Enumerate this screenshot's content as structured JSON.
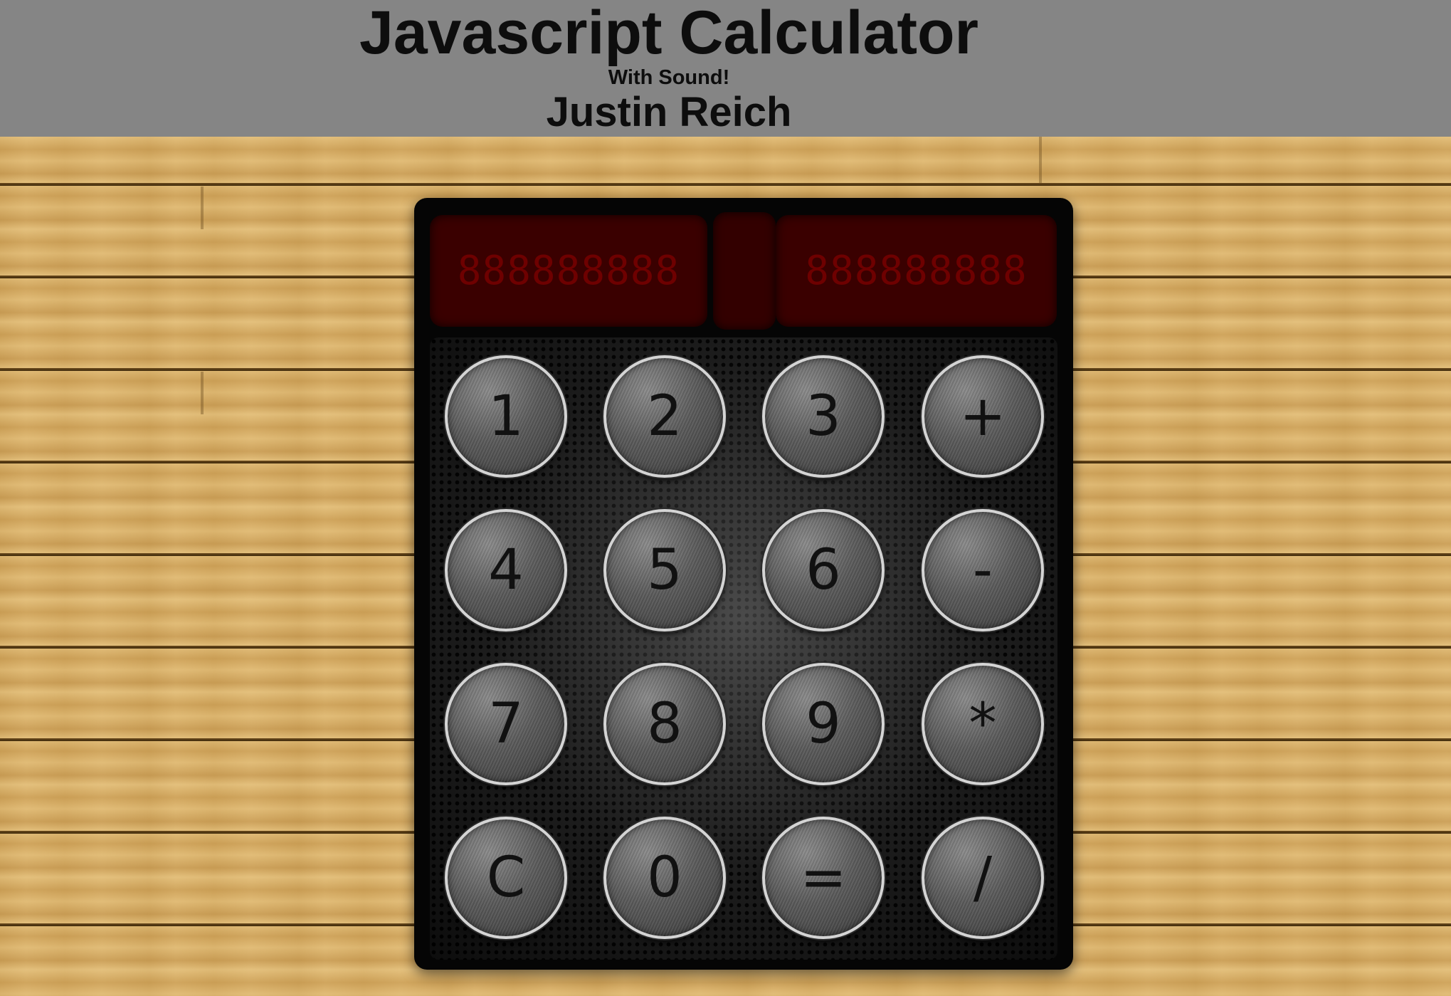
{
  "header": {
    "title": "Javascript Calculator",
    "subtitle": "With Sound!",
    "author": "Justin Reich"
  },
  "display": {
    "left_value": "888888888",
    "right_value": "888888888"
  },
  "keypad": {
    "rows": [
      [
        "1",
        "2",
        "3",
        "+"
      ],
      [
        "4",
        "5",
        "6",
        "-"
      ],
      [
        "7",
        "8",
        "9",
        "*"
      ],
      [
        "C",
        "0",
        "=",
        "/"
      ]
    ]
  },
  "colors": {
    "header_bg": "#858585",
    "wood": "#d8ad63",
    "display_bg": "#3a0000",
    "display_digits": "#6e0000",
    "calculator_body": "#050505"
  }
}
